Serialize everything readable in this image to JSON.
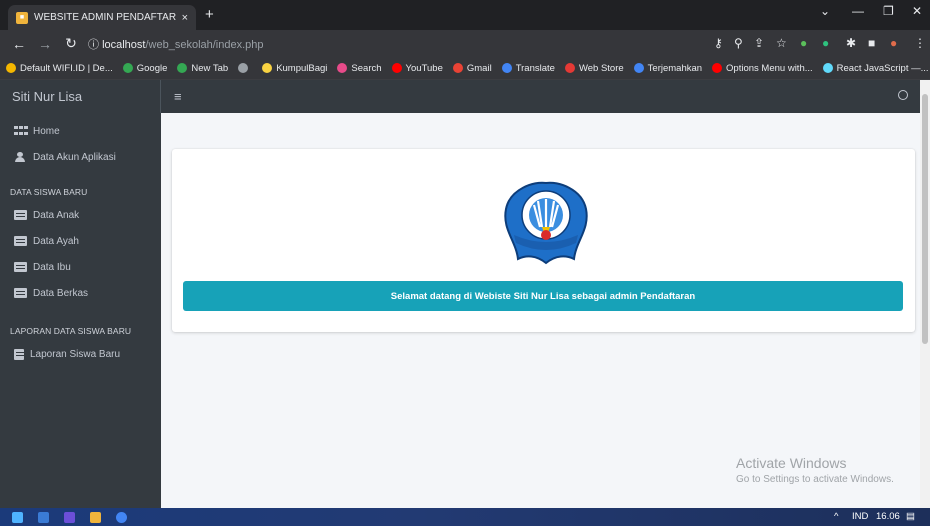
{
  "browser": {
    "tab_title": "WEBSITE ADMIN PENDAFTARAN",
    "tab_close": "×",
    "new_tab": "+",
    "url_host": "localhost",
    "url_path": "/web_sekolah/index.php",
    "bookmarks": [
      {
        "label": "Default WIFI.ID | De...",
        "color": "#f5b700"
      },
      {
        "label": "Google",
        "color": "#34a853"
      },
      {
        "label": "New Tab",
        "color": "#34a853"
      },
      {
        "label": "",
        "color": "#9aa0a6"
      },
      {
        "label": "KumpulBagi",
        "color": "#f9d342"
      },
      {
        "label": "Search",
        "color": "#e84b8a"
      },
      {
        "label": "YouTube",
        "color": "#ff0000"
      },
      {
        "label": "Gmail",
        "color": "#ea4335"
      },
      {
        "label": "Translate",
        "color": "#4285f4"
      },
      {
        "label": "Web Store",
        "color": "#e53935"
      },
      {
        "label": "Terjemahkan",
        "color": "#4285f4"
      },
      {
        "label": "Options Menu with...",
        "color": "#ff0000"
      },
      {
        "label": "React JavaScript —...",
        "color": "#61dafb"
      }
    ]
  },
  "app": {
    "brand": "Siti Nur Lisa",
    "sidebar": {
      "items_top": [
        {
          "label": "Home",
          "icon": "grid-icon"
        },
        {
          "label": "Data Akun Aplikasi",
          "icon": "user-icon"
        }
      ],
      "section1": "DATA SISWA BARU",
      "items_section1": [
        {
          "label": "Data Anak",
          "icon": "id-card-icon"
        },
        {
          "label": "Data Ayah",
          "icon": "id-card-icon"
        },
        {
          "label": "Data Ibu",
          "icon": "id-card-icon"
        },
        {
          "label": "Data Berkas",
          "icon": "id-card-icon"
        }
      ],
      "section2": "LAPORAN DATA SISWA BARU",
      "items_section2": [
        {
          "label": "Laporan Siswa Baru",
          "icon": "file-icon"
        }
      ]
    },
    "welcome": "Selamat datang di Webiste Siti Nur Lisa sebagai admin Pendaftaran",
    "logo_text": "TUT WURI HANDAYANI"
  },
  "watermark": {
    "title": "Activate Windows",
    "subtitle": "Go to Settings to activate Windows."
  },
  "taskbar": {
    "lang": "IND",
    "time": "16.06"
  }
}
